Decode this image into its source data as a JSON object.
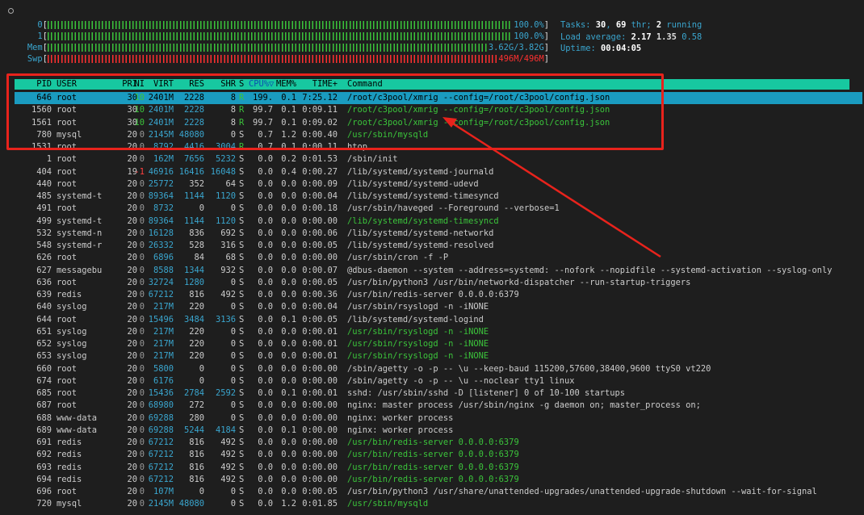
{
  "meters": [
    {
      "label": "0",
      "value": "100.0%",
      "fill": 1.0,
      "color": "#3bc43b"
    },
    {
      "label": "1",
      "value": "100.0%",
      "fill": 1.0,
      "color": "#3bc43b"
    },
    {
      "label": "Mem",
      "value": "3.62G/3.82G",
      "fill": 0.95,
      "color": "#3bc43b"
    },
    {
      "label": "Swp",
      "value": "496M/496M",
      "fill": 1.0,
      "color": "#ff3030"
    }
  ],
  "info": {
    "tasks_label": "Tasks: ",
    "tasks": "30",
    "comma": ", ",
    "threads": "69",
    "thr_label": " thr; ",
    "running": "2",
    "running_label": " running",
    "load_label": "Load average: ",
    "load1": "2.17",
    "load5": "1.35",
    "load15": "0.58",
    "uptime_label": "Uptime: ",
    "uptime": "00:04:05"
  },
  "columns": {
    "pid": "PID",
    "user": "USER",
    "pri": "PRI",
    "ni": "NI",
    "virt": "VIRT",
    "res": "RES",
    "shr": "SHR",
    "s": "S",
    "cpu": "CPU%",
    "sort_icon": "▽",
    "mem": "MEM%",
    "time": "TIME+",
    "cmd": "Command"
  },
  "processes": [
    {
      "pid": "646",
      "user": "root",
      "pri": "30",
      "ni": "10",
      "virt": "2401M",
      "res": "2228",
      "shr": "8",
      "s": "R",
      "cpu": "199.",
      "mem": "0.1",
      "time": "7:25.12",
      "cmd": "/root/c3pool/xmrig --config=/root/c3pool/config.json",
      "thread": false
    },
    {
      "pid": "1560",
      "user": "root",
      "pri": "30",
      "ni": "10",
      "virt": "2401M",
      "res": "2228",
      "shr": "8",
      "s": "R",
      "cpu": "99.7",
      "mem": "0.1",
      "time": "0:09.11",
      "cmd": "/root/c3pool/xmrig --config=/root/c3pool/config.json",
      "thread": true
    },
    {
      "pid": "1561",
      "user": "root",
      "pri": "30",
      "ni": "10",
      "virt": "2401M",
      "res": "2228",
      "shr": "8",
      "s": "R",
      "cpu": "99.7",
      "mem": "0.1",
      "time": "0:09.02",
      "cmd": "/root/c3pool/xmrig --config=/root/c3pool/config.json",
      "thread": true
    },
    {
      "pid": "780",
      "user": "mysql",
      "pri": "20",
      "ni": "0",
      "virt": "2145M",
      "res": "48080",
      "shr": "0",
      "s": "S",
      "cpu": "0.7",
      "mem": "1.2",
      "time": "0:00.40",
      "cmd": "/usr/sbin/mysqld",
      "thread": true
    },
    {
      "pid": "1531",
      "user": "root",
      "pri": "20",
      "ni": "0",
      "virt": "8792",
      "res": "4416",
      "shr": "3004",
      "s": "R",
      "cpu": "0.7",
      "mem": "0.1",
      "time": "0:00.11",
      "cmd": "htop",
      "thread": false
    },
    {
      "pid": "1",
      "user": "root",
      "pri": "20",
      "ni": "0",
      "virt": "162M",
      "res": "7656",
      "shr": "5232",
      "s": "S",
      "cpu": "0.0",
      "mem": "0.2",
      "time": "0:01.53",
      "cmd": "/sbin/init",
      "thread": false
    },
    {
      "pid": "404",
      "user": "root",
      "pri": "19",
      "ni": "-1",
      "virt": "46916",
      "res": "16416",
      "shr": "16048",
      "s": "S",
      "cpu": "0.0",
      "mem": "0.4",
      "time": "0:00.27",
      "cmd": "/lib/systemd/systemd-journald",
      "thread": false
    },
    {
      "pid": "440",
      "user": "root",
      "pri": "20",
      "ni": "0",
      "virt": "25772",
      "res": "352",
      "shr": "64",
      "s": "S",
      "cpu": "0.0",
      "mem": "0.0",
      "time": "0:00.09",
      "cmd": "/lib/systemd/systemd-udevd",
      "thread": false
    },
    {
      "pid": "485",
      "user": "systemd-t",
      "pri": "20",
      "ni": "0",
      "virt": "89364",
      "res": "1144",
      "shr": "1120",
      "s": "S",
      "cpu": "0.0",
      "mem": "0.0",
      "time": "0:00.04",
      "cmd": "/lib/systemd/systemd-timesyncd",
      "thread": false
    },
    {
      "pid": "491",
      "user": "root",
      "pri": "20",
      "ni": "0",
      "virt": "8732",
      "res": "0",
      "shr": "0",
      "s": "S",
      "cpu": "0.0",
      "mem": "0.0",
      "time": "0:00.18",
      "cmd": "/usr/sbin/haveged --Foreground --verbose=1",
      "thread": false
    },
    {
      "pid": "499",
      "user": "systemd-t",
      "pri": "20",
      "ni": "0",
      "virt": "89364",
      "res": "1144",
      "shr": "1120",
      "s": "S",
      "cpu": "0.0",
      "mem": "0.0",
      "time": "0:00.00",
      "cmd": "/lib/systemd/systemd-timesyncd",
      "thread": true
    },
    {
      "pid": "532",
      "user": "systemd-n",
      "pri": "20",
      "ni": "0",
      "virt": "16128",
      "res": "836",
      "shr": "692",
      "s": "S",
      "cpu": "0.0",
      "mem": "0.0",
      "time": "0:00.06",
      "cmd": "/lib/systemd/systemd-networkd",
      "thread": false
    },
    {
      "pid": "548",
      "user": "systemd-r",
      "pri": "20",
      "ni": "0",
      "virt": "26332",
      "res": "528",
      "shr": "316",
      "s": "S",
      "cpu": "0.0",
      "mem": "0.0",
      "time": "0:00.05",
      "cmd": "/lib/systemd/systemd-resolved",
      "thread": false
    },
    {
      "pid": "626",
      "user": "root",
      "pri": "20",
      "ni": "0",
      "virt": "6896",
      "res": "84",
      "shr": "68",
      "s": "S",
      "cpu": "0.0",
      "mem": "0.0",
      "time": "0:00.00",
      "cmd": "/usr/sbin/cron -f -P",
      "thread": false
    },
    {
      "pid": "627",
      "user": "messagebu",
      "pri": "20",
      "ni": "0",
      "virt": "8588",
      "res": "1344",
      "shr": "932",
      "s": "S",
      "cpu": "0.0",
      "mem": "0.0",
      "time": "0:00.07",
      "cmd": "@dbus-daemon --system --address=systemd: --nofork --nopidfile --systemd-activation --syslog-only",
      "thread": false
    },
    {
      "pid": "636",
      "user": "root",
      "pri": "20",
      "ni": "0",
      "virt": "32724",
      "res": "1280",
      "shr": "0",
      "s": "S",
      "cpu": "0.0",
      "mem": "0.0",
      "time": "0:00.05",
      "cmd": "/usr/bin/python3 /usr/bin/networkd-dispatcher --run-startup-triggers",
      "thread": false
    },
    {
      "pid": "639",
      "user": "redis",
      "pri": "20",
      "ni": "0",
      "virt": "67212",
      "res": "816",
      "shr": "492",
      "s": "S",
      "cpu": "0.0",
      "mem": "0.0",
      "time": "0:00.36",
      "cmd": "/usr/bin/redis-server 0.0.0.0:6379",
      "thread": false
    },
    {
      "pid": "640",
      "user": "syslog",
      "pri": "20",
      "ni": "0",
      "virt": "217M",
      "res": "220",
      "shr": "0",
      "s": "S",
      "cpu": "0.0",
      "mem": "0.0",
      "time": "0:00.04",
      "cmd": "/usr/sbin/rsyslogd -n -iNONE",
      "thread": false
    },
    {
      "pid": "644",
      "user": "root",
      "pri": "20",
      "ni": "0",
      "virt": "15496",
      "res": "3484",
      "shr": "3136",
      "s": "S",
      "cpu": "0.0",
      "mem": "0.1",
      "time": "0:00.05",
      "cmd": "/lib/systemd/systemd-logind",
      "thread": false
    },
    {
      "pid": "651",
      "user": "syslog",
      "pri": "20",
      "ni": "0",
      "virt": "217M",
      "res": "220",
      "shr": "0",
      "s": "S",
      "cpu": "0.0",
      "mem": "0.0",
      "time": "0:00.01",
      "cmd": "/usr/sbin/rsyslogd -n -iNONE",
      "thread": true
    },
    {
      "pid": "652",
      "user": "syslog",
      "pri": "20",
      "ni": "0",
      "virt": "217M",
      "res": "220",
      "shr": "0",
      "s": "S",
      "cpu": "0.0",
      "mem": "0.0",
      "time": "0:00.01",
      "cmd": "/usr/sbin/rsyslogd -n -iNONE",
      "thread": true
    },
    {
      "pid": "653",
      "user": "syslog",
      "pri": "20",
      "ni": "0",
      "virt": "217M",
      "res": "220",
      "shr": "0",
      "s": "S",
      "cpu": "0.0",
      "mem": "0.0",
      "time": "0:00.01",
      "cmd": "/usr/sbin/rsyslogd -n -iNONE",
      "thread": true
    },
    {
      "pid": "660",
      "user": "root",
      "pri": "20",
      "ni": "0",
      "virt": "5800",
      "res": "0",
      "shr": "0",
      "s": "S",
      "cpu": "0.0",
      "mem": "0.0",
      "time": "0:00.00",
      "cmd": "/sbin/agetty -o -p -- \\u --keep-baud 115200,57600,38400,9600 ttyS0 vt220",
      "thread": false
    },
    {
      "pid": "674",
      "user": "root",
      "pri": "20",
      "ni": "0",
      "virt": "6176",
      "res": "0",
      "shr": "0",
      "s": "S",
      "cpu": "0.0",
      "mem": "0.0",
      "time": "0:00.00",
      "cmd": "/sbin/agetty -o -p -- \\u --noclear tty1 linux",
      "thread": false
    },
    {
      "pid": "685",
      "user": "root",
      "pri": "20",
      "ni": "0",
      "virt": "15436",
      "res": "2784",
      "shr": "2592",
      "s": "S",
      "cpu": "0.0",
      "mem": "0.1",
      "time": "0:00.01",
      "cmd": "sshd: /usr/sbin/sshd -D [listener] 0 of 10-100 startups",
      "thread": false
    },
    {
      "pid": "687",
      "user": "root",
      "pri": "20",
      "ni": "0",
      "virt": "68980",
      "res": "272",
      "shr": "0",
      "s": "S",
      "cpu": "0.0",
      "mem": "0.0",
      "time": "0:00.00",
      "cmd": "nginx: master process /usr/sbin/nginx -g daemon on; master_process on;",
      "thread": false
    },
    {
      "pid": "688",
      "user": "www-data",
      "pri": "20",
      "ni": "0",
      "virt": "69288",
      "res": "280",
      "shr": "0",
      "s": "S",
      "cpu": "0.0",
      "mem": "0.0",
      "time": "0:00.00",
      "cmd": "nginx: worker process",
      "thread": false
    },
    {
      "pid": "689",
      "user": "www-data",
      "pri": "20",
      "ni": "0",
      "virt": "69288",
      "res": "5244",
      "shr": "4184",
      "s": "S",
      "cpu": "0.0",
      "mem": "0.1",
      "time": "0:00.00",
      "cmd": "nginx: worker process",
      "thread": false
    },
    {
      "pid": "691",
      "user": "redis",
      "pri": "20",
      "ni": "0",
      "virt": "67212",
      "res": "816",
      "shr": "492",
      "s": "S",
      "cpu": "0.0",
      "mem": "0.0",
      "time": "0:00.00",
      "cmd": "/usr/bin/redis-server 0.0.0.0:6379",
      "thread": true
    },
    {
      "pid": "692",
      "user": "redis",
      "pri": "20",
      "ni": "0",
      "virt": "67212",
      "res": "816",
      "shr": "492",
      "s": "S",
      "cpu": "0.0",
      "mem": "0.0",
      "time": "0:00.00",
      "cmd": "/usr/bin/redis-server 0.0.0.0:6379",
      "thread": true
    },
    {
      "pid": "693",
      "user": "redis",
      "pri": "20",
      "ni": "0",
      "virt": "67212",
      "res": "816",
      "shr": "492",
      "s": "S",
      "cpu": "0.0",
      "mem": "0.0",
      "time": "0:00.00",
      "cmd": "/usr/bin/redis-server 0.0.0.0:6379",
      "thread": true
    },
    {
      "pid": "694",
      "user": "redis",
      "pri": "20",
      "ni": "0",
      "virt": "67212",
      "res": "816",
      "shr": "492",
      "s": "S",
      "cpu": "0.0",
      "mem": "0.0",
      "time": "0:00.00",
      "cmd": "/usr/bin/redis-server 0.0.0.0:6379",
      "thread": true
    },
    {
      "pid": "696",
      "user": "root",
      "pri": "20",
      "ni": "0",
      "virt": "107M",
      "res": "0",
      "shr": "0",
      "s": "S",
      "cpu": "0.0",
      "mem": "0.0",
      "time": "0:00.05",
      "cmd": "/usr/bin/python3 /usr/share/unattended-upgrades/unattended-upgrade-shutdown --wait-for-signal",
      "thread": false
    },
    {
      "pid": "720",
      "user": "mysql",
      "pri": "20",
      "ni": "0",
      "virt": "2145M",
      "res": "48080",
      "shr": "0",
      "s": "S",
      "cpu": "0.0",
      "mem": "1.2",
      "time": "0:01.85",
      "cmd": "/usr/sbin/mysqld",
      "thread": true
    }
  ],
  "annotation_color": "#e8231c"
}
